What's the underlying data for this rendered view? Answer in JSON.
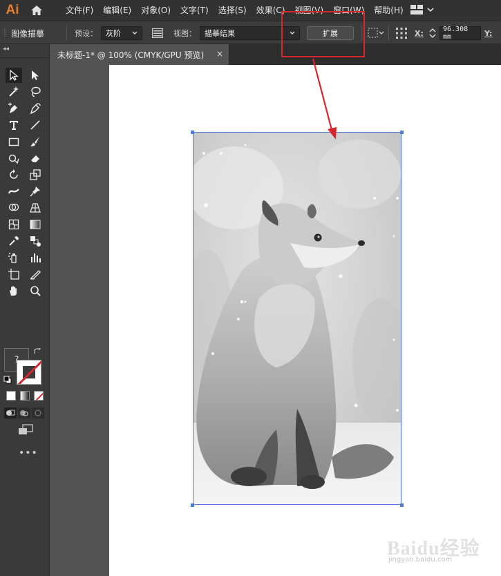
{
  "app": {
    "logo": "Ai"
  },
  "menu": {
    "items": [
      "文件(F)",
      "编辑(E)",
      "对象(O)",
      "文字(T)",
      "选择(S)",
      "效果(C)",
      "视图(V)",
      "窗口(W)",
      "帮助(H)"
    ]
  },
  "control_bar": {
    "panel_label": "图像描摹",
    "preset_label": "预设：",
    "preset_value": "灰阶",
    "view_label": "视图：",
    "view_value": "描摹结果",
    "expand_button": "扩展",
    "x_label": "X:",
    "x_value": "96.308 mm",
    "y_label": "Y:"
  },
  "document": {
    "tab_title": "未标题-1* @ 100% (CMYK/GPU 预览)",
    "close_glyph": "×"
  },
  "tools": {
    "fill_glyph": "?",
    "more_glyph": "•••"
  },
  "watermark": {
    "text": "Baidu经验",
    "sub": "jingyan.baidu.com"
  },
  "colors": {
    "annotation": "#d8262c",
    "selection": "#4d7ad6",
    "app_orange": "#e87f2a"
  }
}
